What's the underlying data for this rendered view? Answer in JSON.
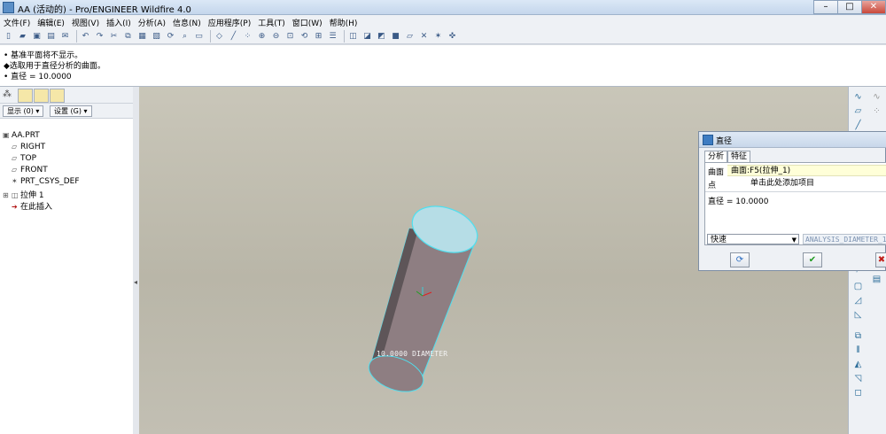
{
  "window": {
    "title": "AA (活动的) - Pro/ENGINEER Wildfire 4.0",
    "min": "–",
    "max": "□",
    "close": "✕"
  },
  "menu": [
    "文件(F)",
    "编辑(E)",
    "视图(V)",
    "插入(I)",
    "分析(A)",
    "信息(N)",
    "应用程序(P)",
    "工具(T)",
    "窗口(W)",
    "帮助(H)"
  ],
  "messages": {
    "line1": "• 基准平面将不显示。",
    "line2": "◆选取用于直径分析的曲面。",
    "line3": "• 直径 = 10.0000"
  },
  "left_panel": {
    "show_button": "显示 (0) ▾",
    "settings_button": "设置 (G) ▾",
    "tree": {
      "root": "AA.PRT",
      "right": "RIGHT",
      "top": "TOP",
      "front": "FRONT",
      "csys": "PRT_CSYS_DEF",
      "extrude": "拉伸 1",
      "insert_here": "在此插入"
    }
  },
  "viewport": {
    "dimension_label": "10.0000 DIAMETER"
  },
  "dialog": {
    "title": "直径",
    "tab_analysis": "分析",
    "tab_feature": "特征",
    "surface_label": "曲面",
    "surface_value": "曲面:F5(拉伸_1)",
    "point_label": "点",
    "point_value": "单击此处添加项目",
    "result": "直径 = 10.0000",
    "mode": "快速",
    "feature_name": "ANALYSIS_DIAMETER_1"
  },
  "colors": {
    "accent": "#3d7cc2",
    "viewport_bg": "#c4c1b4",
    "cylinder_fill": "#8e7e82",
    "edge_highlight": "#4fe0f0"
  }
}
